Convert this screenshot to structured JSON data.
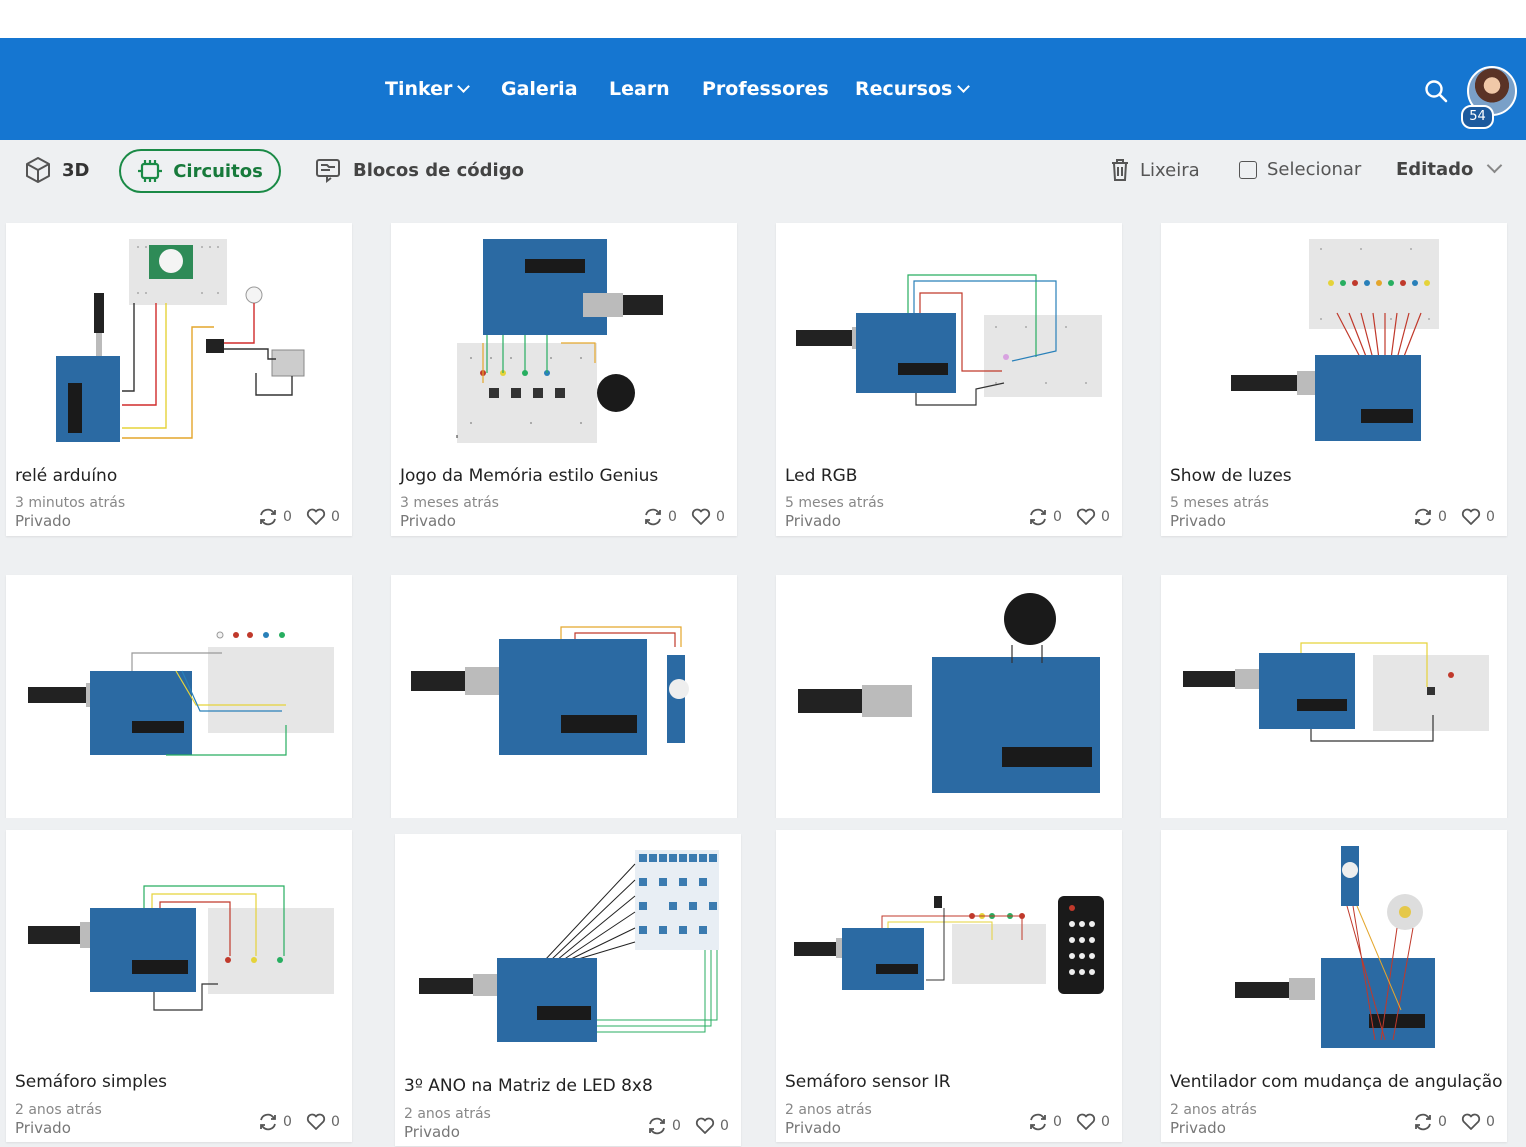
{
  "nav": {
    "items": [
      {
        "label": "Tinker",
        "has_menu": true
      },
      {
        "label": "Galeria",
        "has_menu": false
      },
      {
        "label": "Learn",
        "has_menu": false
      },
      {
        "label": "Professores",
        "has_menu": false
      },
      {
        "label": "Recursos",
        "has_menu": true
      }
    ],
    "notification_count": "54"
  },
  "toolbar": {
    "tab_3d": "3D",
    "tab_circuitos": "Circuitos",
    "tab_blocos": "Blocos de código",
    "lixeira": "Lixeira",
    "selecionar": "Selecionar",
    "sort": "Editado"
  },
  "cards": [
    {
      "title": "relé arduíno",
      "date": "3 minutos atrás",
      "privacy": "Privado",
      "remixes": "0",
      "likes": "0"
    },
    {
      "title": "Jogo da Memória estilo Genius",
      "date": "3 meses atrás",
      "privacy": "Privado",
      "remixes": "0",
      "likes": "0"
    },
    {
      "title": "Led RGB",
      "date": "5 meses atrás",
      "privacy": "Privado",
      "remixes": "0",
      "likes": "0"
    },
    {
      "title": "Show de luzes",
      "date": "5 meses atrás",
      "privacy": "Privado",
      "remixes": "0",
      "likes": "0"
    },
    {
      "title": "",
      "date": "",
      "privacy": "",
      "remixes": "",
      "likes": ""
    },
    {
      "title": "",
      "date": "",
      "privacy": "",
      "remixes": "",
      "likes": ""
    },
    {
      "title": "",
      "date": "",
      "privacy": "",
      "remixes": "",
      "likes": ""
    },
    {
      "title": "",
      "date": "",
      "privacy": "",
      "remixes": "",
      "likes": ""
    },
    {
      "title": "Semáforo simples",
      "date": "2 anos atrás",
      "privacy": "Privado",
      "remixes": "0",
      "likes": "0"
    },
    {
      "title": "3º ANO na Matriz de LED 8x8",
      "date": "2 anos atrás",
      "privacy": "Privado",
      "remixes": "0",
      "likes": "0"
    },
    {
      "title": "Semáforo sensor IR",
      "date": "2 anos atrás",
      "privacy": "Privado",
      "remixes": "0",
      "likes": "0"
    },
    {
      "title": "Ventilador com mudança de angulação",
      "date": "2 anos atrás",
      "privacy": "Privado",
      "remixes": "0",
      "likes": "0"
    }
  ],
  "colors": {
    "nav_bg": "#1576d1",
    "accent_green": "#1a8a46",
    "arduino_blue": "#2b6aa3",
    "page_bg": "#eef0f2"
  },
  "icons": [
    "search-icon",
    "cube-icon",
    "chip-icon",
    "code-blocks-icon",
    "trash-icon",
    "checkbox-icon",
    "chevron-down-icon",
    "remix-icon",
    "heart-icon"
  ]
}
